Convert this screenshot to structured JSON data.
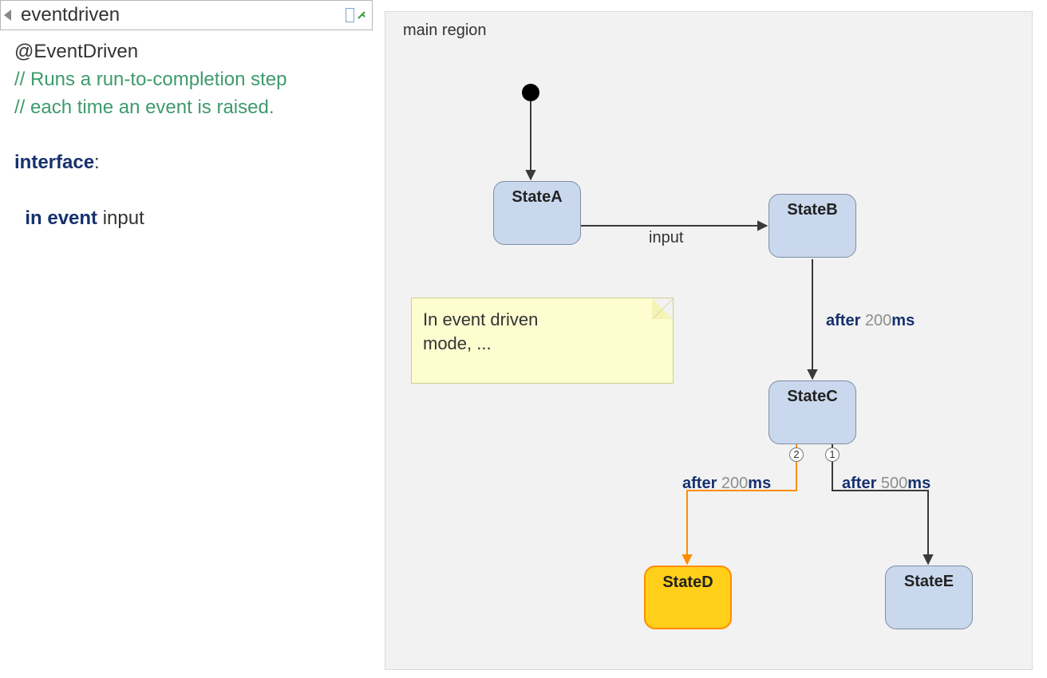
{
  "header": {
    "title": "eventdriven",
    "back_icon": "triangle-left",
    "pin_icon": "pin-icon"
  },
  "definition": {
    "lines": [
      {
        "kind": "anno",
        "text": "@EventDriven"
      },
      {
        "kind": "comment",
        "text": "// Runs a run-to-completion step"
      },
      {
        "kind": "comment",
        "text": "// each time an event is raised."
      },
      {
        "kind": "blank",
        "text": ""
      },
      {
        "kind": "iface",
        "kw": "interface",
        "suffix": ":"
      },
      {
        "kind": "blank",
        "text": ""
      },
      {
        "kind": "decl",
        "indent": "  ",
        "kw": "in event",
        "name": " input"
      }
    ]
  },
  "region": {
    "title": "main region",
    "note_line1": "In event driven",
    "note_line2": "mode, ...",
    "states": {
      "A": "StateA",
      "B": "StateB",
      "C": "StateC",
      "D": "StateD",
      "E": "StateE"
    },
    "transitions": {
      "A_to_B": {
        "label": "input"
      },
      "B_to_C": {
        "kw": "after",
        "num": "200",
        "unit": "ms"
      },
      "C_to_D": {
        "kw": "after",
        "num": "200",
        "unit": "ms",
        "priority": "2"
      },
      "C_to_E": {
        "kw": "after",
        "num": "500",
        "unit": "ms",
        "priority": "1"
      }
    }
  }
}
